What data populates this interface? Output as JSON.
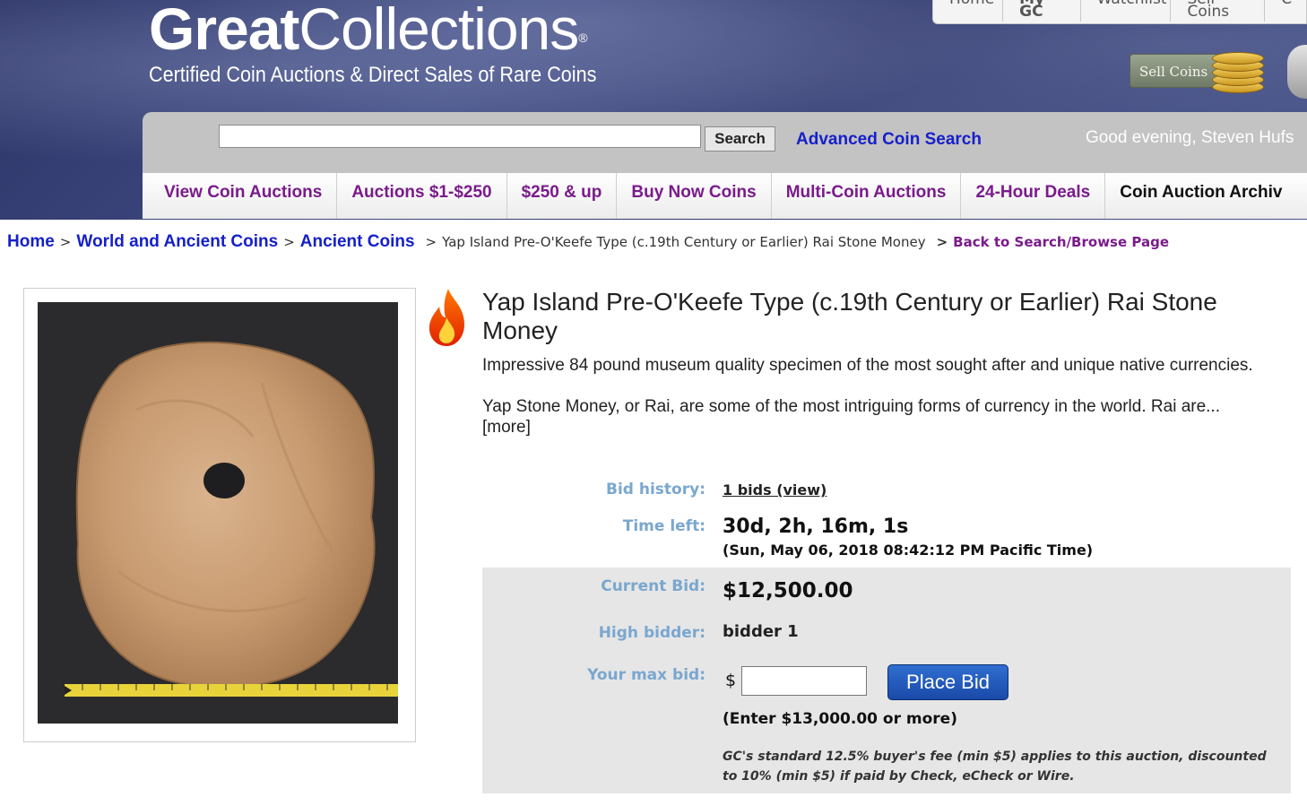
{
  "brand": {
    "name_bold": "Great",
    "name_thin": "Collections",
    "registered_mark": "®",
    "tagline": "Certified Coin Auctions & Direct Sales of Rare Coins"
  },
  "top_nav": [
    "Home",
    "My GC",
    "Watchlist",
    "Sell Coins",
    "C"
  ],
  "sell_coins_badge": "Sell Coins",
  "search": {
    "placeholder": "",
    "button_label": "Search",
    "advanced_label": "Advanced Coin Search"
  },
  "greeting": "Good evening, Steven Hufs",
  "main_nav": [
    "View Coin Auctions",
    "Auctions $1-$250",
    "$250 & up",
    "Buy Now Coins",
    "Multi-Coin Auctions",
    "24-Hour Deals",
    "Coin Auction Archiv"
  ],
  "breadcrumb": {
    "items": [
      "Home",
      "World and Ancient Coins",
      "Ancient Coins"
    ],
    "separator": ">",
    "current": "Yap Island Pre-O'Keefe Type (c.19th Century or Earlier) Rai Stone Money",
    "back_label": "Back to Search/Browse Page"
  },
  "lot": {
    "title": "Yap Island Pre-O'Keefe Type (c.19th Century or Earlier) Rai Stone Money",
    "summary": "Impressive 84 pound museum quality specimen of the most sought after and unique native currencies.",
    "description": "Yap Stone Money, or Rai, are some of the most intriguing forms of currency in the world. Rai are...",
    "more_label": "[more]"
  },
  "bid": {
    "history_label": "Bid history:",
    "history_value": "1 bids (view)",
    "time_left_label": "Time left:",
    "time_left_value": "30d, 2h, 16m, 1s",
    "end_time": "(Sun, May 06, 2018 08:42:12 PM Pacific Time)",
    "current_bid_label": "Current Bid:",
    "current_bid_value": "$12,500.00",
    "high_bidder_label": "High bidder:",
    "high_bidder_value": "bidder 1",
    "max_bid_label": "Your max bid:",
    "currency_symbol": "$",
    "max_bid_value": "",
    "place_bid_label": "Place Bid",
    "min_bid_note": "(Enter $13,000.00 or more)",
    "fee_note": "GC's standard 12.5% buyer's fee (min $5) applies to this auction, discounted to 10% (min $5) if paid by Check, eCheck or Wire."
  },
  "colors": {
    "header_bg": "#323b70",
    "link_blue": "#1620c8",
    "nav_purple": "#7a1b8b",
    "label_blue": "#7aa7cf",
    "bid_box_bg": "#e6e6e6",
    "button_blue": "#1a4aa8"
  },
  "icons": [
    "flame-icon",
    "coin-stack-icon",
    "shield-icon"
  ]
}
